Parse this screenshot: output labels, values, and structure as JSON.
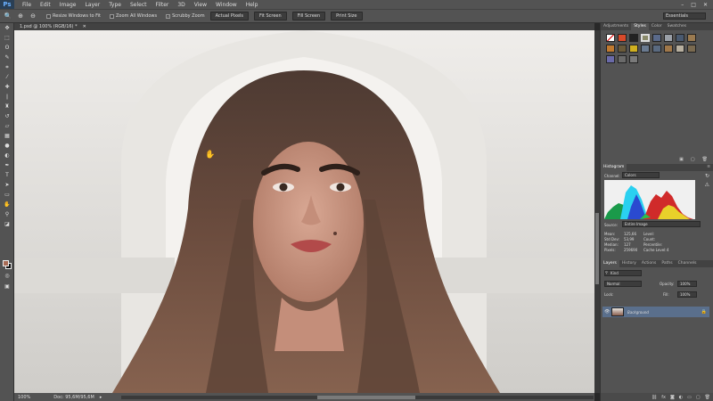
{
  "menubar": {
    "logo": "Ps",
    "items": [
      "File",
      "Edit",
      "Image",
      "Layer",
      "Type",
      "Select",
      "Filter",
      "3D",
      "View",
      "Window",
      "Help"
    ]
  },
  "optionsbar": {
    "checks": [
      {
        "label": "Resize Windows to Fit",
        "checked": false
      },
      {
        "label": "Zoom All Windows",
        "checked": false
      },
      {
        "label": "Scrubby Zoom",
        "checked": true
      }
    ],
    "buttons": [
      "Actual Pixels",
      "Fit Screen",
      "Fill Screen",
      "Print Size"
    ],
    "workspace": "Essentials"
  },
  "document": {
    "tab_title": "1.psd @ 100% (RGB/16) *"
  },
  "statusbar": {
    "zoom": "100%",
    "doc_size": "Doc: 95,6M/95,6M"
  },
  "styles_panel": {
    "tabs": [
      "Adjustments",
      "Styles",
      "Color",
      "Swatches"
    ],
    "active": "Styles"
  },
  "histogram_panel": {
    "tabs": [
      "Histogram"
    ],
    "channel_label": "Channel:",
    "channel_value": "Colors",
    "source_label": "Source:",
    "source_value": "Entire Image",
    "stats_left": [
      {
        "k": "Mean:",
        "v": "125,66"
      },
      {
        "k": "Std Dev:",
        "v": "53,99"
      },
      {
        "k": "Median:",
        "v": "127"
      },
      {
        "k": "Pixels:",
        "v": "259690"
      }
    ],
    "stats_right": [
      {
        "k": "Level:",
        "v": ""
      },
      {
        "k": "Count:",
        "v": ""
      },
      {
        "k": "Percentile:",
        "v": ""
      },
      {
        "k": "Cache Level:",
        "v": "4"
      }
    ]
  },
  "layers_panel": {
    "tabs": [
      "Layers",
      "History",
      "Actions",
      "Paths",
      "Channels"
    ],
    "active": "Layers",
    "kind_label": "Kind",
    "blend_mode": "Normal",
    "opacity_label": "Opacity:",
    "opacity_value": "100%",
    "lock_label": "Lock:",
    "fill_label": "Fill:",
    "fill_value": "100%",
    "layers": [
      {
        "name": "Background",
        "visible": true,
        "locked": true
      }
    ]
  },
  "colors": {
    "foreground": "#a86b55",
    "background": "#111111"
  }
}
